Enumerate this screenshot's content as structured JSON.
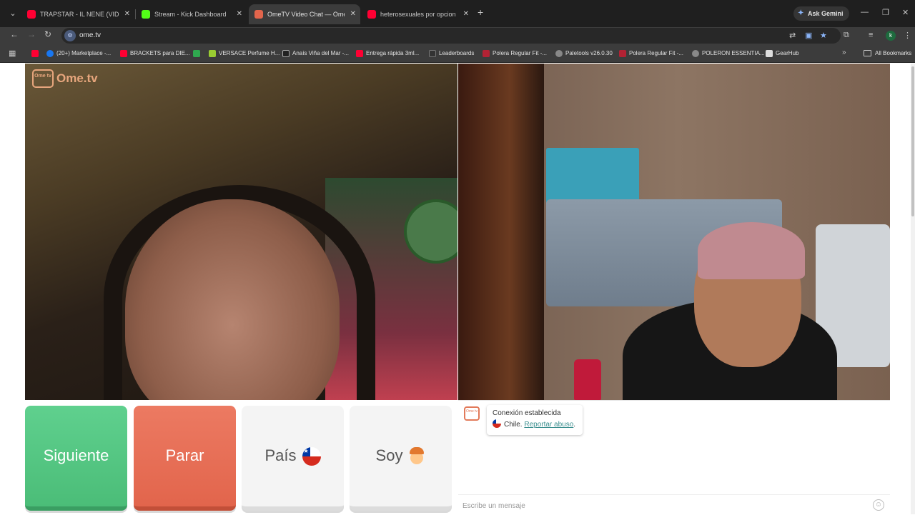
{
  "browser": {
    "tabs": [
      {
        "title": "TRAPSTAR - IL NENE (VIDEO O...",
        "favicon_color": "#ff0033"
      },
      {
        "title": "Stream - Kick Dashboard",
        "favicon_color": "#53fc18"
      },
      {
        "title": "OmeTV Video Chat — Ome...",
        "favicon_color": "#e2654c"
      },
      {
        "title": "heterosexuales por opcion ofic...",
        "favicon_color": "#ff0033"
      }
    ],
    "tab_close_glyph": "✕",
    "new_tab_glyph": "+",
    "gemini_label": "Ask Gemini",
    "url": "ome.tv",
    "profile_initial": "k",
    "bookmarks": [
      {
        "label": "",
        "favicon_color": "#ff0033"
      },
      {
        "label": "(20+) Marketplace -...",
        "favicon_color": "#1877f2"
      },
      {
        "label": "BRACKETS para DIE...",
        "favicon_color": "#ff0033"
      },
      {
        "label": "",
        "favicon_color": "#2fa84f"
      },
      {
        "label": "VERSACE Perfume H...",
        "favicon_color": "#9acd32"
      },
      {
        "label": "Anaís Viña del Mar -...",
        "favicon_color": "#222222"
      },
      {
        "label": "Entrega rápida 3ml...",
        "favicon_color": "#ff0033"
      },
      {
        "label": "Leaderboards",
        "favicon_color": "#333333"
      },
      {
        "label": "Polera Regular Fit -...",
        "favicon_color": "#b22234"
      },
      {
        "label": "Paletools v26.0.30",
        "favicon_color": "#888888"
      },
      {
        "label": "Polera Regular Fit -...",
        "favicon_color": "#b22234"
      },
      {
        "label": "POLERON ESSENTIA...",
        "favicon_color": "#888888"
      },
      {
        "label": "GearHub",
        "favicon_color": "#dddddd"
      }
    ],
    "all_bookmarks_label": "All Bookmarks"
  },
  "page": {
    "logo_text": "Ome.tv",
    "logo_box_text": "Ome tv",
    "buttons": {
      "next": "Siguiente",
      "stop": "Parar",
      "country": "País",
      "gender": "Soy"
    },
    "chat": {
      "system_title": "Conexión establecida",
      "country": "Chile.",
      "report_link": "Reportar abuso",
      "report_suffix": ".",
      "input_placeholder": "Escribe un mensaje"
    }
  },
  "colors": {
    "next_button": "#4bbd78",
    "stop_button": "#e2654c",
    "report_link": "#3a8e8e"
  }
}
